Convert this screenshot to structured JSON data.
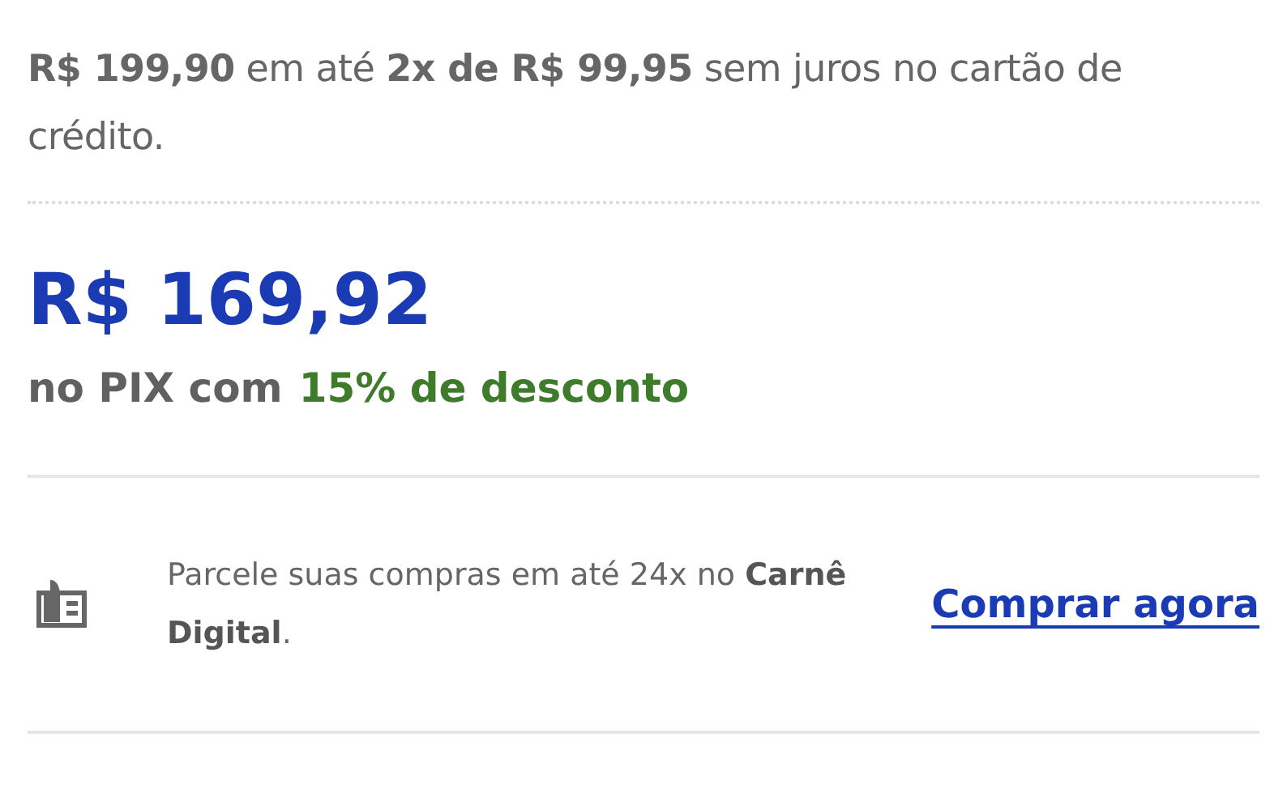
{
  "installments": {
    "text": "**R$ 199,90** em até **2x de R$ 99,95** sem juros no cartão de crédito."
  },
  "pix": {
    "price": "R$ 169,92",
    "label": "no PIX com",
    "discount": "15% de desconto"
  },
  "carne": {
    "text": "Parcele suas compras em até 24x no **Carnê Digital**.",
    "link": "Comprar agora"
  }
}
